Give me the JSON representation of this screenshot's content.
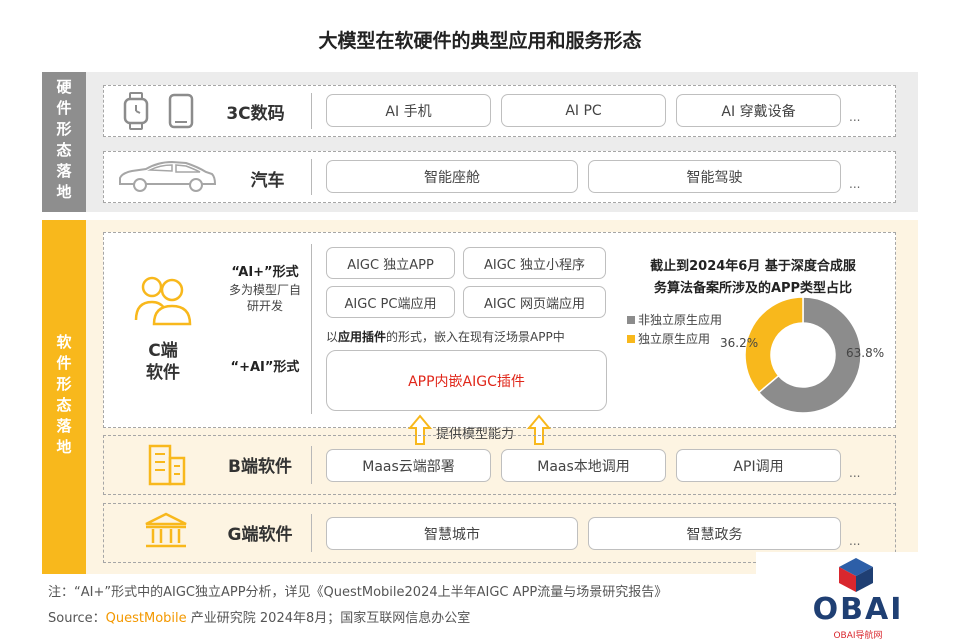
{
  "title": "大模型在软硬件的典型应用和服务形态",
  "hardware": {
    "section_label": "硬件形态落地",
    "rows": [
      {
        "label": "3C数码",
        "items": [
          "AI 手机",
          "AI PC",
          "AI 穿戴设备"
        ],
        "more": "..."
      },
      {
        "label": "汽车",
        "items": [
          "智能座舱",
          "智能驾驶"
        ],
        "more": "..."
      }
    ]
  },
  "software": {
    "section_label": "软件形态落地",
    "c_end": {
      "label_line1": "C端",
      "label_line2": "软件",
      "ai_plus_title": "“AI+”形式",
      "ai_plus_desc_line1": "多为模型厂自",
      "ai_plus_desc_line2": "研开发",
      "plus_ai_title": "“+AI”形式",
      "aigc_items": [
        "AIGC 独立APP",
        "AIGC 独立小程序",
        "AIGC PC端应用",
        "AIGC 网页端应用"
      ],
      "plugin_note_prefix": "以",
      "plugin_note_highlight": "应用插件",
      "plugin_note_suffix": "的形式，嵌入在现有泛场景APP中",
      "plugin_box": "APP内嵌AIGC插件",
      "provide_label": "提供模型能力"
    },
    "pie": {
      "title_line1": "截止到2024年6月 基于深度合成服",
      "title_line2": "务算法备案所涉及的APP类型占比",
      "legend_1": "非独立原生应用",
      "legend_2": "独立原生应用",
      "value_label_1": "63.8%",
      "value_label_2": "36.2%",
      "color_1": "#8c8c8c",
      "color_2": "#f8b81c"
    },
    "b_end": {
      "label": "B端软件",
      "items": [
        "Maas云端部署",
        "Maas本地调用",
        "API调用"
      ],
      "more": "..."
    },
    "g_end": {
      "label": "G端软件",
      "items": [
        "智慧城市",
        "智慧政务"
      ],
      "more": "..."
    }
  },
  "chart_data": {
    "type": "pie",
    "title": "截止到2024年6月 基于深度合成服务算法备案所涉及的APP类型占比",
    "categories": [
      "非独立原生应用",
      "独立原生应用"
    ],
    "values": [
      63.8,
      36.2
    ],
    "unit": "%",
    "colors": [
      "#8c8c8c",
      "#f8b81c"
    ],
    "legend_position": "left"
  },
  "footer": {
    "note": "注：“AI+”形式中的AIGC独立APP分析，详见《QuestMobile2024上半年AIGC APP流量与场景研究报告》",
    "source_prefix": "Source：",
    "source_brand": "QuestMobile",
    "source_suffix": " 产业研究院 2024年8月；国家互联网信息办公室"
  },
  "logo": {
    "text": "OBAI",
    "subtext": "OBAI导航网"
  },
  "icons": {
    "watch": "smartwatch-icon",
    "phone": "phone-icon",
    "car": "car-icon",
    "users": "users-icon",
    "building": "building-icon",
    "government": "government-building-icon"
  }
}
